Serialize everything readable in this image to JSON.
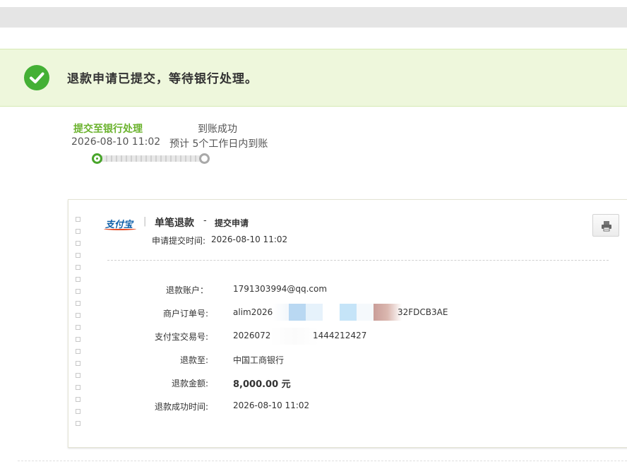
{
  "banner": {
    "message": "退款申请已提交，等待银行处理。"
  },
  "steps": [
    {
      "title": "提交至银行处理",
      "detail": "2026-08-10 11:02"
    },
    {
      "title": "到账成功",
      "detail": "预计 5个工作日内到账"
    }
  ],
  "progress": {
    "current_step": 1,
    "total_steps": 2
  },
  "card": {
    "logo_text": "支付宝",
    "separator": "|",
    "title": "单笔退款",
    "dash": "-",
    "subtitle": "提交申请",
    "submit_time_label": "申请提交时间:",
    "submit_time_value": "2026-08-10 11:02",
    "print_icon": "printer-icon",
    "details": [
      {
        "label": "退款账户：",
        "value": "1791303994@qq.com"
      },
      {
        "label": "商户订单号:",
        "value_prefix": "alim202607",
        "value_suffix": "32FDCB3AE"
      },
      {
        "label": "支付宝交易号:",
        "value_prefix": "2026072",
        "value_suffix": "1444212427"
      },
      {
        "label": "退款至:",
        "value": "中国工商银行"
      },
      {
        "label": "退款金额:",
        "value": "8,000.00 元"
      },
      {
        "label": "退款成功时间:",
        "value": "2026-08-10 11:02"
      }
    ]
  },
  "colors": {
    "accent_green": "#44b035",
    "banner_bg": "#eef7dc",
    "step_active": "#6ab22c"
  }
}
